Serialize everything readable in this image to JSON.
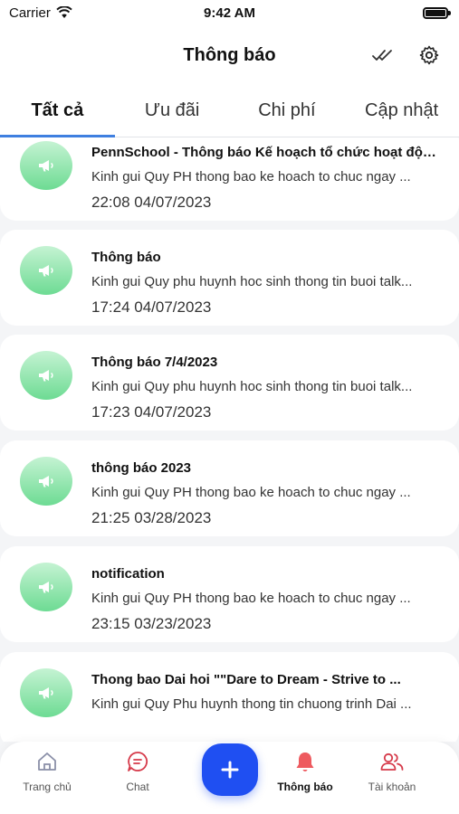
{
  "statusbar": {
    "carrier": "Carrier",
    "time": "9:42 AM"
  },
  "header": {
    "title": "Thông báo"
  },
  "tabs": [
    {
      "label": "Tất cả",
      "active": true
    },
    {
      "label": "Ưu đãi",
      "active": false
    },
    {
      "label": "Chi phí",
      "active": false
    },
    {
      "label": "Cập nhật",
      "active": false
    }
  ],
  "notifications": [
    {
      "title": "PennSchool - Thông báo Kế hoạch tổ chức hoạt độn...",
      "body": "Kinh gui Quy PH thong bao ke hoach to chuc ngay ...",
      "time": "22:08 04/07/2023"
    },
    {
      "title": "Thông báo",
      "body": "Kinh gui Quy phu huynh hoc sinh thong tin buoi talk...",
      "time": "17:24 04/07/2023"
    },
    {
      "title": "Thông báo 7/4/2023",
      "body": "Kinh gui Quy phu huynh hoc sinh thong tin buoi talk...",
      "time": "17:23 04/07/2023"
    },
    {
      "title": "thông báo 2023",
      "body": "Kinh gui Quy PH thong bao ke hoach to chuc ngay ...",
      "time": "21:25 03/28/2023"
    },
    {
      "title": "notification",
      "body": "Kinh gui Quy PH thong bao ke hoach to chuc ngay ...",
      "time": "23:15 03/23/2023"
    },
    {
      "title": "Thong bao Dai hoi \"\"Dare to Dream - Strive to ...",
      "body": "Kinh gui Quy Phu huynh thong tin chuong trinh Dai ...",
      "time": ""
    }
  ],
  "bottom_nav": {
    "home": "Trang chủ",
    "chat": "Chat",
    "notifications": "Thông báo",
    "account": "Tài khoản"
  },
  "colors": {
    "accent": "#3f7fe0",
    "fab": "#1f4ff2",
    "icon_red": "#d63a4a",
    "icon_green": "#6ddb93"
  },
  "icons": {
    "header": [
      "double-check-icon",
      "gear-icon"
    ],
    "item": "megaphone-icon",
    "nav": [
      "home-icon",
      "chat-icon",
      "plus-icon",
      "bell-icon",
      "users-icon"
    ]
  }
}
